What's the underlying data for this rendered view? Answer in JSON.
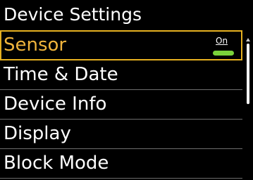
{
  "header": {
    "title": "Device Settings"
  },
  "menu": {
    "items": [
      {
        "label": "Sensor",
        "selected": true,
        "toggle": {
          "state_label": "On",
          "color": "#7ad23a"
        }
      },
      {
        "label": "Time & Date"
      },
      {
        "label": "Device Info"
      },
      {
        "label": "Display"
      },
      {
        "label": "Block Mode"
      }
    ]
  },
  "scrollbar": {
    "position_fraction": 0
  },
  "colors": {
    "background": "#000000",
    "highlight": "#e6b020",
    "selected_text": "#f0b43c",
    "divider": "#6e6e6e",
    "toggle_on": "#7ad23a"
  }
}
